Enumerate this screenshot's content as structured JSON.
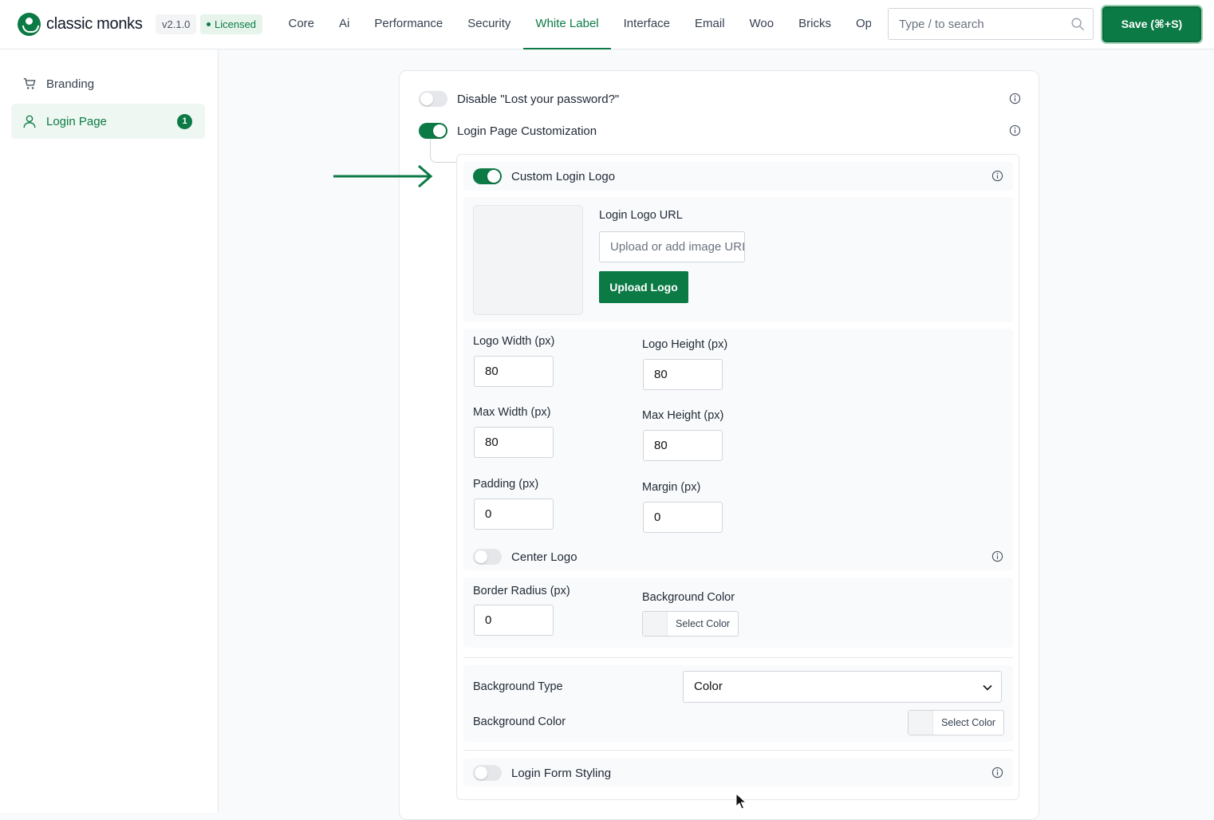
{
  "app": {
    "logo_text": "classic monks",
    "version": "v2.1.0",
    "license_status": "Licensed",
    "brand_color": "#0b7a45"
  },
  "nav": {
    "items": [
      "Core",
      "Ai",
      "Performance",
      "Security",
      "White Label",
      "Interface",
      "Email",
      "Woo",
      "Bricks",
      "Opt"
    ],
    "active": "White Label"
  },
  "search": {
    "placeholder": "Type / to search",
    "icon": "search-icon"
  },
  "toolbar": {
    "save_label": "Save (⌘+S)"
  },
  "sidebar": {
    "items": [
      {
        "label": "Branding",
        "icon": "cart-icon"
      },
      {
        "label": "Login Page",
        "icon": "user-icon",
        "badge": "1",
        "active": true
      }
    ]
  },
  "settings": {
    "disable_lost_password": {
      "label": "Disable \"Lost your password?\"",
      "enabled": false
    },
    "login_page_customization": {
      "label": "Login Page Customization",
      "enabled": true
    },
    "custom_login_logo": {
      "label": "Custom Login Logo",
      "enabled": true
    },
    "login_logo_url": {
      "label": "Login Logo URL",
      "placeholder": "Upload or add image URL",
      "value": ""
    },
    "upload_button": "Upload Logo",
    "logo_width": {
      "label": "Logo Width (px)",
      "value": "80"
    },
    "logo_height": {
      "label": "Logo Height (px)",
      "value": "80"
    },
    "max_width": {
      "label": "Max Width (px)",
      "value": "80"
    },
    "max_height": {
      "label": "Max Height (px)",
      "value": "80"
    },
    "padding": {
      "label": "Padding (px)",
      "value": "0"
    },
    "margin": {
      "label": "Margin (px)",
      "value": "0"
    },
    "center_logo": {
      "label": "Center Logo",
      "enabled": false
    },
    "border_radius": {
      "label": "Border Radius (px)",
      "value": "0"
    },
    "logo_bg_color": {
      "label": "Background Color",
      "button": "Select Color"
    },
    "background_type": {
      "label": "Background Type",
      "value": "Color"
    },
    "page_bg_color": {
      "label": "Background Color",
      "button": "Select Color"
    },
    "login_form_styling": {
      "label": "Login Form Styling",
      "enabled": false
    }
  }
}
